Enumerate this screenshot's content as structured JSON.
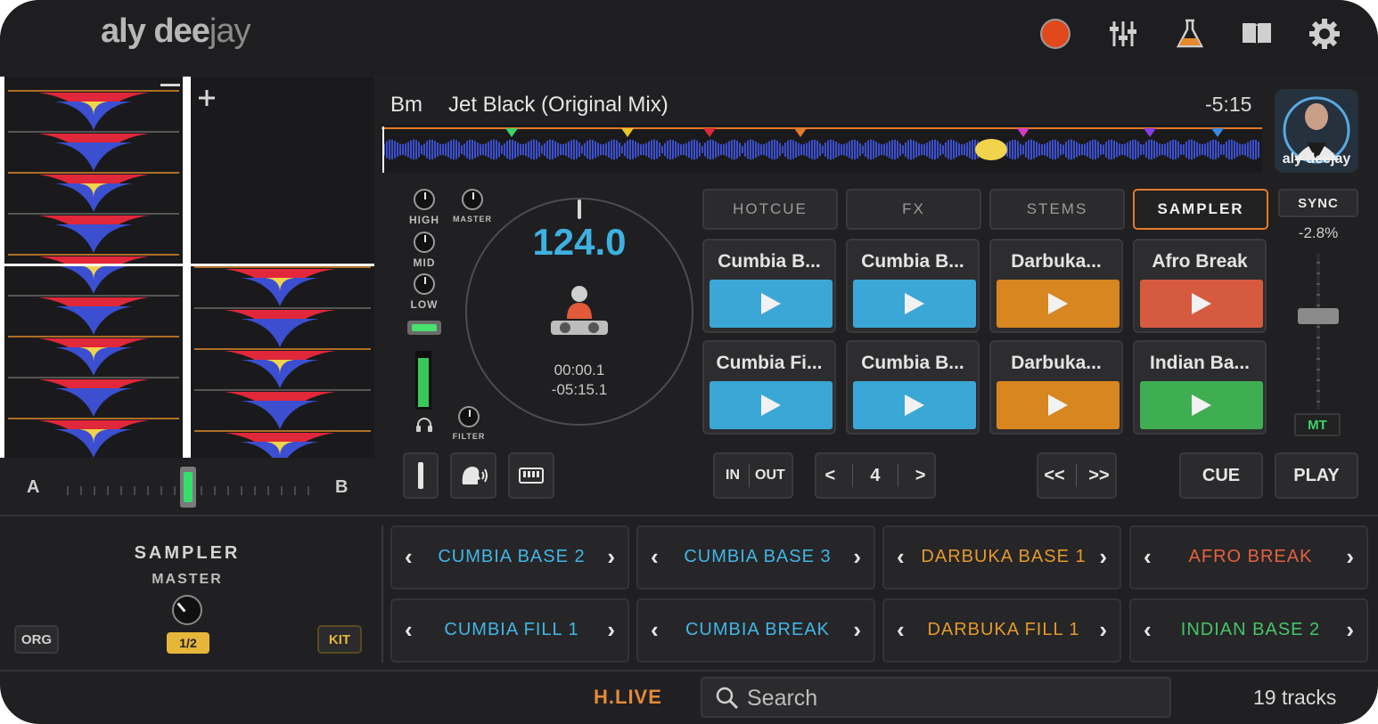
{
  "app": {
    "logo_main": "aly dee",
    "logo_tail": "jay"
  },
  "toolbar": {
    "icons": [
      "record-icon",
      "mixer-sliders-icon",
      "flask-icon",
      "book-icon",
      "gear-icon"
    ]
  },
  "crossfader": {
    "left_label": "A",
    "right_label": "B",
    "level": 0.5
  },
  "deck": {
    "key": "Bm",
    "title": "Jet Black (Original Mix)",
    "remaining": "-5:15",
    "avatar_label": "aly deejay",
    "bpm": "124.0",
    "elapsed": "00:00.1",
    "remaining_detail": "-05:15.1",
    "pitch": "-2.8%",
    "sync_label": "SYNC",
    "mt_label": "MT",
    "eq": {
      "high": "HIGH",
      "master": "MASTER",
      "mid": "MID",
      "low": "LOW",
      "filter": "FILTER"
    },
    "volume_level": 0.92
  },
  "tabs": [
    "HOTCUE",
    "FX",
    "STEMS",
    "SAMPLER"
  ],
  "active_tab": "SAMPLER",
  "pads": [
    {
      "label": "Cumbia B...",
      "color": "#3aa7d6"
    },
    {
      "label": "Cumbia B...",
      "color": "#3aa7d6"
    },
    {
      "label": "Darbuka...",
      "color": "#d8861f"
    },
    {
      "label": "Afro Break",
      "color": "#d65a3f"
    },
    {
      "label": "Cumbia Fi...",
      "color": "#3aa7d6"
    },
    {
      "label": "Cumbia B...",
      "color": "#3aa7d6"
    },
    {
      "label": "Darbuka...",
      "color": "#d8861f"
    },
    {
      "label": "Indian Ba...",
      "color": "#3fae53"
    }
  ],
  "transport": {
    "in_label": "IN",
    "out_label": "OUT",
    "loop_prev": "<",
    "loop_size": "4",
    "loop_next": ">",
    "jump_back": "<<",
    "jump_fwd": ">>",
    "cue_label": "CUE",
    "play_label": "PLAY"
  },
  "sampler": {
    "title": "SAMPLER",
    "master_label": "MASTER",
    "ratio": "1/2",
    "org_label": "ORG",
    "kit_label": "KIT",
    "slots": [
      {
        "name": "CUMBIA BASE 2",
        "color": "#41b6e6"
      },
      {
        "name": "CUMBIA BASE 3",
        "color": "#41b6e6"
      },
      {
        "name": "DARBUKA BASE 1",
        "color": "#e49a2a"
      },
      {
        "name": "AFRO BREAK",
        "color": "#e5613f"
      },
      {
        "name": "CUMBIA FILL 1",
        "color": "#41b6e6"
      },
      {
        "name": "CUMBIA BREAK",
        "color": "#41b6e6"
      },
      {
        "name": "DARBUKA FILL 1",
        "color": "#e49a2a"
      },
      {
        "name": "INDIAN BASE 2",
        "color": "#45c567"
      }
    ]
  },
  "footer": {
    "source_label": "H.LIVE",
    "search_placeholder": "Search",
    "track_count": "19 tracks"
  },
  "colors": {
    "accent_orange": "#e47a2c",
    "bpm_blue": "#3eb1e0",
    "wave_blue": "#3b4fd0",
    "wave_red": "#e0283a",
    "wave_yellow": "#f1d44b"
  }
}
